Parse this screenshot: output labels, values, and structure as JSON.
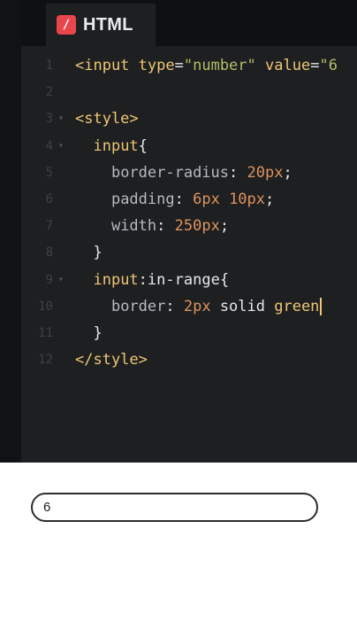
{
  "tab": {
    "label": "HTML",
    "icon": "/"
  },
  "lines": [
    {
      "n": "1",
      "fold": "",
      "tokens": [
        {
          "c": "tag",
          "t": "<input"
        },
        {
          "c": "kw",
          "t": " "
        },
        {
          "c": "attr",
          "t": "type"
        },
        {
          "c": "punc",
          "t": "="
        },
        {
          "c": "str",
          "t": "\"number\""
        },
        {
          "c": "kw",
          "t": " "
        },
        {
          "c": "attr",
          "t": "value"
        },
        {
          "c": "punc",
          "t": "="
        },
        {
          "c": "str",
          "t": "\"6"
        }
      ]
    },
    {
      "n": "2",
      "fold": "",
      "tokens": []
    },
    {
      "n": "3",
      "fold": "▾",
      "tokens": [
        {
          "c": "tag",
          "t": "<style>"
        }
      ]
    },
    {
      "n": "4",
      "fold": "▾",
      "tokens": [
        {
          "c": "kw",
          "t": "  "
        },
        {
          "c": "sel",
          "t": "input"
        },
        {
          "c": "punc",
          "t": "{"
        }
      ]
    },
    {
      "n": "5",
      "fold": "",
      "tokens": [
        {
          "c": "kw",
          "t": "    "
        },
        {
          "c": "prop",
          "t": "border-radius"
        },
        {
          "c": "punc",
          "t": ": "
        },
        {
          "c": "num",
          "t": "20px"
        },
        {
          "c": "punc",
          "t": ";"
        }
      ]
    },
    {
      "n": "6",
      "fold": "",
      "tokens": [
        {
          "c": "kw",
          "t": "    "
        },
        {
          "c": "prop",
          "t": "padding"
        },
        {
          "c": "punc",
          "t": ": "
        },
        {
          "c": "num",
          "t": "6px"
        },
        {
          "c": "kw",
          "t": " "
        },
        {
          "c": "num",
          "t": "10px"
        },
        {
          "c": "punc",
          "t": ";"
        }
      ]
    },
    {
      "n": "7",
      "fold": "",
      "tokens": [
        {
          "c": "kw",
          "t": "    "
        },
        {
          "c": "prop",
          "t": "width"
        },
        {
          "c": "punc",
          "t": ": "
        },
        {
          "c": "num",
          "t": "250px"
        },
        {
          "c": "punc",
          "t": ";"
        }
      ]
    },
    {
      "n": "8",
      "fold": "",
      "tokens": [
        {
          "c": "kw",
          "t": "  "
        },
        {
          "c": "punc",
          "t": "}"
        }
      ]
    },
    {
      "n": "9",
      "fold": "▾",
      "tokens": [
        {
          "c": "kw",
          "t": "  "
        },
        {
          "c": "sel",
          "t": "input"
        },
        {
          "c": "punc",
          "t": ":"
        },
        {
          "c": "kw",
          "t": "in-range"
        },
        {
          "c": "punc",
          "t": "{"
        }
      ]
    },
    {
      "n": "10",
      "fold": "",
      "tokens": [
        {
          "c": "kw",
          "t": "    "
        },
        {
          "c": "prop",
          "t": "border"
        },
        {
          "c": "punc",
          "t": ": "
        },
        {
          "c": "num",
          "t": "2px"
        },
        {
          "c": "kw",
          "t": " solid "
        },
        {
          "c": "sel",
          "t": "green"
        }
      ],
      "cursor": true
    },
    {
      "n": "11",
      "fold": "",
      "tokens": [
        {
          "c": "kw",
          "t": "  "
        },
        {
          "c": "punc",
          "t": "}"
        }
      ]
    },
    {
      "n": "12",
      "fold": "",
      "tokens": [
        {
          "c": "tag",
          "t": "</style>"
        }
      ]
    }
  ],
  "preview": {
    "input_value": "6"
  },
  "colors": {
    "editor_bg": "#1d1f21",
    "tab_icon": "#e8454c",
    "tag": "#f0c674",
    "string": "#b5bd68",
    "number": "#de935f"
  }
}
